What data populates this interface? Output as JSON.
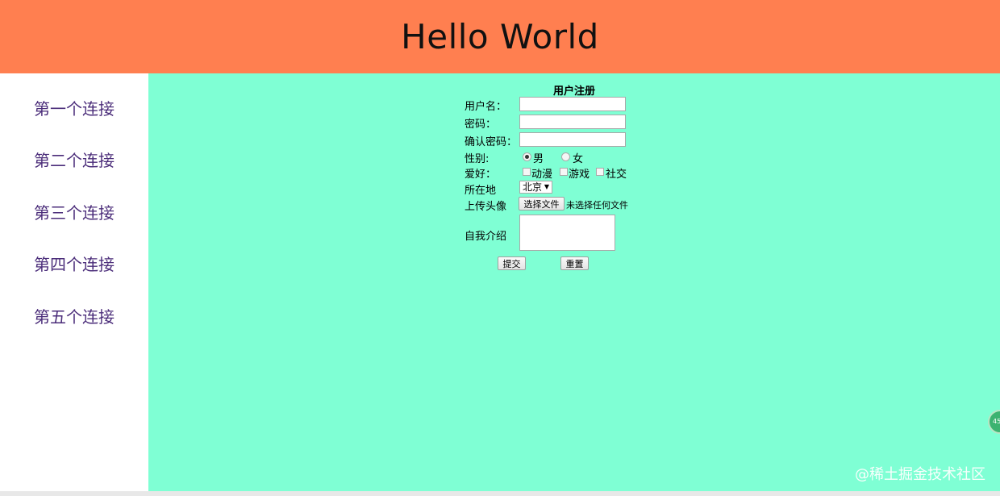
{
  "header": {
    "title": "Hello World"
  },
  "sidebar": {
    "links": [
      {
        "label": "第一个连接"
      },
      {
        "label": "第二个连接"
      },
      {
        "label": "第三个连接"
      },
      {
        "label": "第四个连接"
      },
      {
        "label": "第五个连接"
      }
    ]
  },
  "form": {
    "title": "用户注册",
    "username_label": "用户名：",
    "password_label": "密码：",
    "confirm_label": "确认密码：",
    "gender_label": "性别:",
    "gender_male": "男",
    "gender_female": "女",
    "hobby_label": "爱好：",
    "hobbies": [
      "动漫",
      "游戏",
      "社交"
    ],
    "location_label": "所在地",
    "location_value": "北京",
    "avatar_label": "上传头像",
    "choose_file": "选择文件",
    "file_status": "未选择任何文件",
    "intro_label": "自我介绍",
    "submit": "提交",
    "reset": "重置"
  },
  "watermark": "@稀土掘金技术社区",
  "colors": {
    "header_bg": "#ff7f50",
    "main_bg": "#7fffd4",
    "link": "#4b2d7a"
  }
}
